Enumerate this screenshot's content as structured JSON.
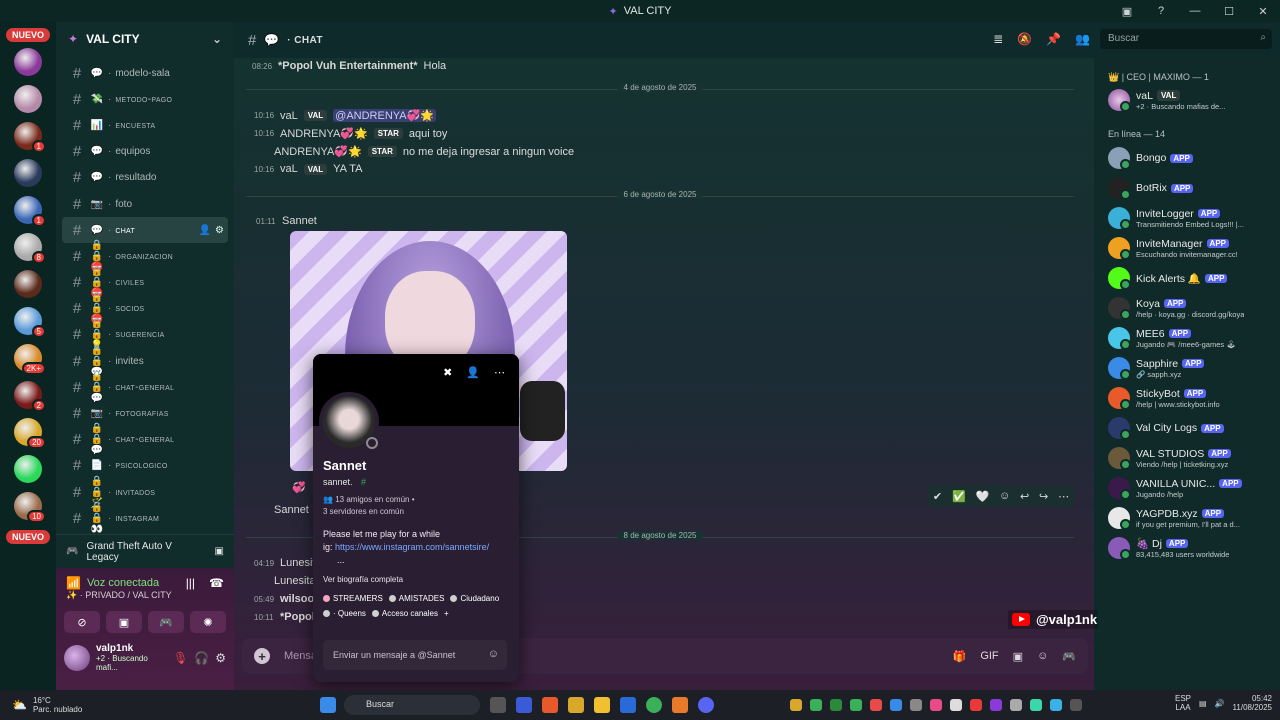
{
  "window": {
    "title": "VAL CITY"
  },
  "rail": {
    "top_pill": "NUEVO",
    "bottom_pill": "NUEVO",
    "servers": [
      {
        "color": "#8a3a9a",
        "badge": ""
      },
      {
        "color": "#b58aa8",
        "badge": ""
      },
      {
        "color": "#7a2a1a",
        "badge": "1"
      },
      {
        "color": "#2a3a5a",
        "badge": ""
      },
      {
        "color": "#3a66b5",
        "badge": "1"
      },
      {
        "color": "#aaaaaa",
        "badge": "8"
      },
      {
        "color": "#5a2a1a",
        "badge": ""
      },
      {
        "color": "#5a9ad8",
        "badge": "5"
      },
      {
        "color": "#d88a2a",
        "badge": "2K+"
      },
      {
        "color": "#7a1a1a",
        "badge": "2"
      },
      {
        "color": "#d8a82a",
        "badge": "20"
      },
      {
        "color": "#2ad85a",
        "badge": ""
      },
      {
        "color": "#9a6a4a",
        "badge": "10"
      }
    ]
  },
  "sidebar": {
    "guild_name": "VAL CITY",
    "channels": [
      {
        "name": "modelo-sala",
        "icon": "💬",
        "sc": false
      },
      {
        "name": "metodo-pago",
        "icon": "💸",
        "sc": true
      },
      {
        "name": "encuesta",
        "icon": "📊",
        "sc": true
      },
      {
        "name": "equipos",
        "icon": "💬",
        "sc": false
      },
      {
        "name": "resultado",
        "icon": "💬",
        "sc": false
      },
      {
        "name": "foto",
        "icon": "📷",
        "sc": false
      },
      {
        "name": "chat",
        "icon": "💬",
        "sc": true
      },
      {
        "name": "organizacion",
        "icon": "🔒🔒⛔",
        "sc": true
      },
      {
        "name": "civiles",
        "icon": "🔒🔒⛔",
        "sc": true
      },
      {
        "name": "socios",
        "icon": "🔒🔒⛔",
        "sc": true
      },
      {
        "name": "sugerencia",
        "icon": "🔒🔒💡",
        "sc": true
      },
      {
        "name": "invites",
        "icon": "🔒🔒💬",
        "sc": false
      },
      {
        "name": "chat-general",
        "icon": "🔒🔒💬",
        "sc": true
      },
      {
        "name": "fotografias",
        "icon": "📷",
        "sc": true
      },
      {
        "name": "chat-general",
        "icon": "🔒🔒💬",
        "sc": true
      },
      {
        "name": "psicologico",
        "icon": "📄",
        "sc": true
      },
      {
        "name": "invitados",
        "icon": "🔒🔒🪄",
        "sc": true
      },
      {
        "name": "instagram",
        "icon": "🔒🔒👀",
        "sc": true
      }
    ],
    "game": "Grand Theft Auto V Legacy",
    "voice": {
      "title": "Voz conectada",
      "sub": "PRIVADO / VAL CITY"
    },
    "user": {
      "name": "valp1nk",
      "status": "+2 · Buscando mafi..."
    }
  },
  "header": {
    "channel": "CHAT"
  },
  "search": {
    "placeholder": "Buscar"
  },
  "messages": {
    "m1": {
      "ts": "08:26",
      "author": "*Popol Vuh Entertainment*",
      "text": "Hola"
    },
    "date1": "4 de agosto de 2025",
    "m2": {
      "ts": "10:16",
      "author": "vaL",
      "tag": "VAL",
      "text": "@ANDRENYA💞🌟"
    },
    "m3": {
      "ts": "10:16",
      "author": "ANDRENYA💞🌟",
      "tag": "STAR",
      "text": "aqui toy"
    },
    "m4": {
      "author": "ANDRENYA💞🌟",
      "tag": "STAR",
      "text": "no me deja ingresar a ningun voice"
    },
    "m5": {
      "ts": "10:16",
      "author": "vaL",
      "tag": "VAL",
      "text": "YA TA"
    },
    "date2": "6 de agosto de 2025",
    "m6": {
      "ts": "01:11",
      "author": "Sannet"
    },
    "m7": {
      "author": "Sannet"
    },
    "date3": "8 de agosto de 2025",
    "m8": {
      "ts": "04:19",
      "author": "Lunesita"
    },
    "m9": {
      "author": "Lunesita"
    },
    "m10": {
      "ts": "05:49",
      "author": "wilsooor"
    },
    "m11": {
      "ts": "10:11",
      "author": "*Popol V"
    }
  },
  "profile": {
    "name": "Sannet",
    "username": "sannet.",
    "mutual_friends": "13 amigos en común",
    "mutual_servers": "3 servidores en común",
    "bio_line1": "Please let me play for a while",
    "bio_prefix": "ig: ",
    "bio_link": "https://www.instagram.com/sannetsire/",
    "bio_more": "...",
    "full_bio": "Ver biografía completa",
    "roles": [
      "STREAMERS",
      "AMISTADES",
      "Ciudadano",
      "· Queens",
      "Acceso canales"
    ],
    "dm_placeholder": "Enviar un mensaje a @Sannet"
  },
  "composer": {
    "placeholder": "Mensa"
  },
  "watermark": "@valp1nk",
  "members": {
    "owner_section": "👑 | CEO | MAXIMO — 1",
    "owner": {
      "name": "vaL",
      "tag": "VAL",
      "status": "+2 · Buscando mafias de..."
    },
    "online_section": "En línea — 14",
    "list": [
      {
        "name": "Bongo",
        "sub": "",
        "color": "#8aa0b8"
      },
      {
        "name": "BotRix",
        "sub": "",
        "color": "#222"
      },
      {
        "name": "InviteLogger",
        "sub": "Transmitiendo Embed Logs!!! |...",
        "color": "#3ab0d8"
      },
      {
        "name": "InviteManager",
        "sub": "Escuchando invitemanager.cc!",
        "color": "#f0a020"
      },
      {
        "name": "Kick Alerts 🔔",
        "sub": "",
        "color": "#53fc18"
      },
      {
        "name": "Koya",
        "sub": "/help · koya.gg · discord.gg/koya",
        "color": "#333"
      },
      {
        "name": "MEE6",
        "sub": "Jugando 🎮 /mee6-games 🕹",
        "color": "#49c5e8"
      },
      {
        "name": "Sapphire",
        "sub": "🔗 sapph.xyz",
        "color": "#3a8ae8"
      },
      {
        "name": "StickyBot",
        "sub": "/help | www.stickybot.info",
        "color": "#e85a2a"
      },
      {
        "name": "Val City Logs",
        "sub": "",
        "color": "#2a3a6a"
      },
      {
        "name": "VAL STUDIOS",
        "sub": "Viendo /help | ticketking.xyz",
        "color": "#6a5a3a"
      },
      {
        "name": "VANILLA UNIC...",
        "sub": "Jugando /help",
        "color": "#3a1a4a"
      },
      {
        "name": "YAGPDB.xyz",
        "sub": "if you get premium, I'll pat a d...",
        "color": "#e8e8e8"
      },
      {
        "name": "🍇 Dj",
        "sub": "83,415,483 users worldwide",
        "color": "#8a5ab8"
      }
    ],
    "app_label": "APP"
  },
  "taskbar": {
    "temp": "16°C",
    "weather": "Parc. nublado",
    "search": "Buscar",
    "lang1": "ESP",
    "lang2": "LAA",
    "time": "05:42",
    "date": "11/08/2025"
  }
}
